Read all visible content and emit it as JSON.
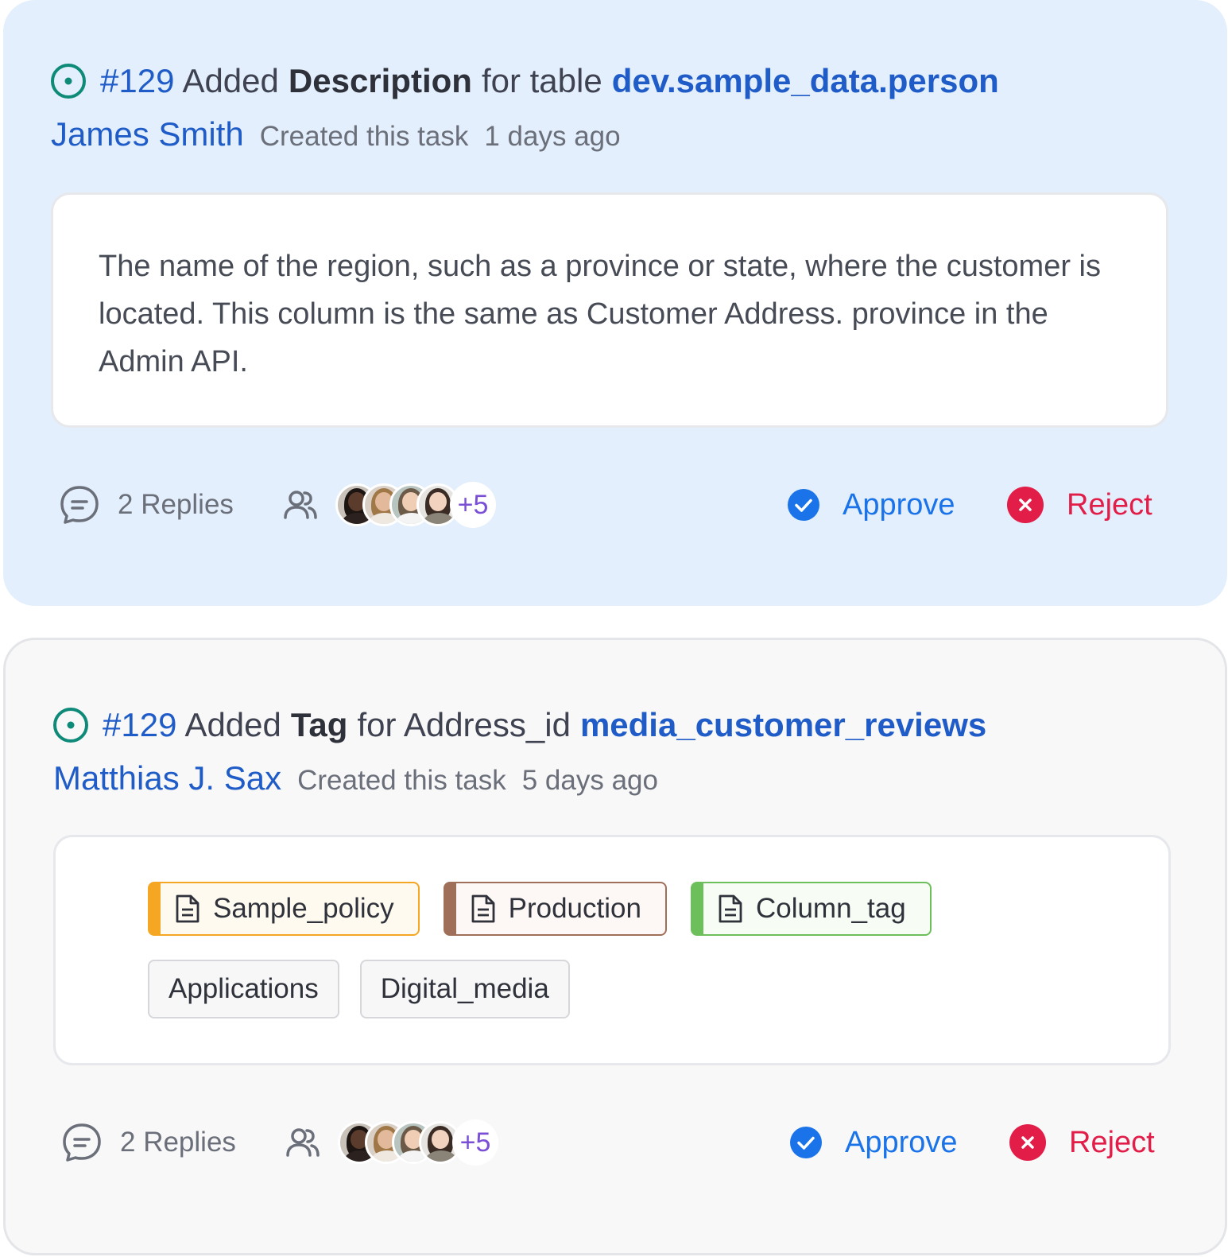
{
  "tasks": [
    {
      "id": "#129",
      "action": "Added",
      "field": "Description",
      "connector": "for table",
      "entity": "dev.sample_data.person",
      "author": "James Smith",
      "created_label": "Created this task",
      "time_ago": "1 days ago",
      "description": "The name of the region, such as a province or state, where the customer is located. This column is the same as Customer Address. province in the Admin API.",
      "replies": "2 Replies",
      "more_assignees": "+5",
      "approve_label": "Approve",
      "reject_label": "Reject",
      "background": "#e3effc"
    },
    {
      "id": "#129",
      "action": "Added",
      "field": "Tag",
      "connector": "for Address_id",
      "entity": "media_customer_reviews",
      "author": "Matthias J. Sax",
      "created_label": "Created this task",
      "time_ago": "5 days ago",
      "tags": [
        {
          "label": "Sample_policy",
          "icon": "document-icon",
          "color": "#f5a623",
          "bg": "#fffaf0"
        },
        {
          "label": "Production",
          "icon": "document-icon",
          "color": "#a06f5a",
          "bg": "#fdf7f5"
        },
        {
          "label": "Column_tag",
          "icon": "document-icon",
          "color": "#6cbf5a",
          "bg": "#f7fcf5"
        }
      ],
      "plain_tags": [
        "Applications",
        "Digital_media"
      ],
      "replies": "2 Replies",
      "more_assignees": "+5",
      "approve_label": "Approve",
      "reject_label": "Reject",
      "background": "#f8f8f9"
    }
  ],
  "colors": {
    "link": "#1f5cc8",
    "approve": "#1a73e8",
    "reject": "#e11d48",
    "status_icon": "#0e8a78",
    "more_count": "#7a4fd6"
  }
}
